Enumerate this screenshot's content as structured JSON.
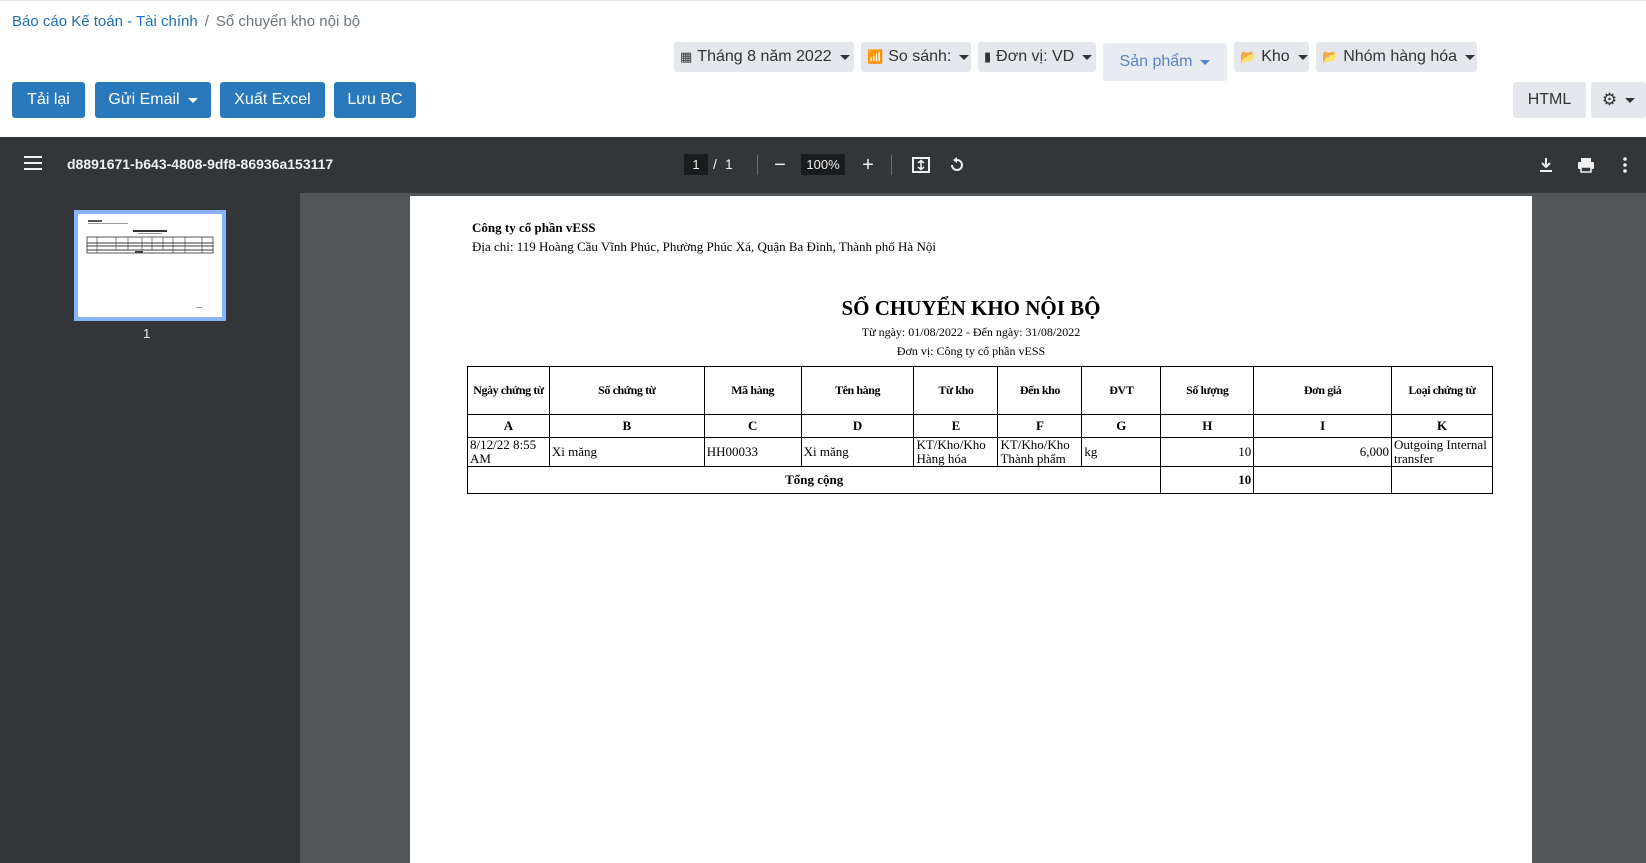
{
  "breadcrumb": {
    "root": "Báo cáo Kế toán - Tài chính",
    "current": "Sổ chuyển kho nội bộ"
  },
  "filters": {
    "period": "Tháng 8 năm 2022",
    "compare": "So sánh:",
    "unit": "Đơn vị: VD",
    "product": "Sản phẩm",
    "warehouse": "Kho",
    "product_group": "Nhóm hàng hóa"
  },
  "actions": {
    "reload": "Tải lại",
    "send_email": "Gửi Email",
    "export_excel": "Xuất Excel",
    "save_report": "Lưu BC",
    "html": "HTML"
  },
  "viewer": {
    "doc_title": "d8891671-b643-4808-9df8-86936a153117",
    "current_page": "1",
    "page_sep": "/",
    "total_pages": "1",
    "zoom": "100%",
    "thumb_label": "1"
  },
  "report": {
    "company": "Công ty cổ phần vESS",
    "address": "Địa chỉ: 119 Hoàng Cầu Vĩnh Phúc, Phường Phúc Xá, Quận Ba Đình, Thành phố Hà Nội",
    "title": "SỔ CHUYỂN KHO NỘI BỘ",
    "date_range": "Từ ngày: 01/08/2022 - Đến ngày: 31/08/2022",
    "unit": "Đơn vị: Công ty cổ phần vESS",
    "headers": [
      "Ngày chứng từ",
      "Số chứng từ",
      "Mã hàng",
      "Tên hàng",
      "Từ kho",
      "Đến kho",
      "ĐVT",
      "Số lượng",
      "Đơn giá",
      "Loại chứng từ"
    ],
    "letters": [
      "A",
      "B",
      "C",
      "D",
      "E",
      "F",
      "G",
      "H",
      "I",
      "K"
    ],
    "rows": [
      [
        "8/12/22 8:55 AM",
        "Xi măng",
        "HH00033",
        "Xi măng",
        "KT/Kho/Kho Hàng hóa",
        "KT/Kho/Kho Thành phẩm",
        "kg",
        "10",
        "6,000",
        "Outgoing Internal transfer"
      ]
    ],
    "total_label": "Tổng cộng",
    "total_qty": "10"
  }
}
